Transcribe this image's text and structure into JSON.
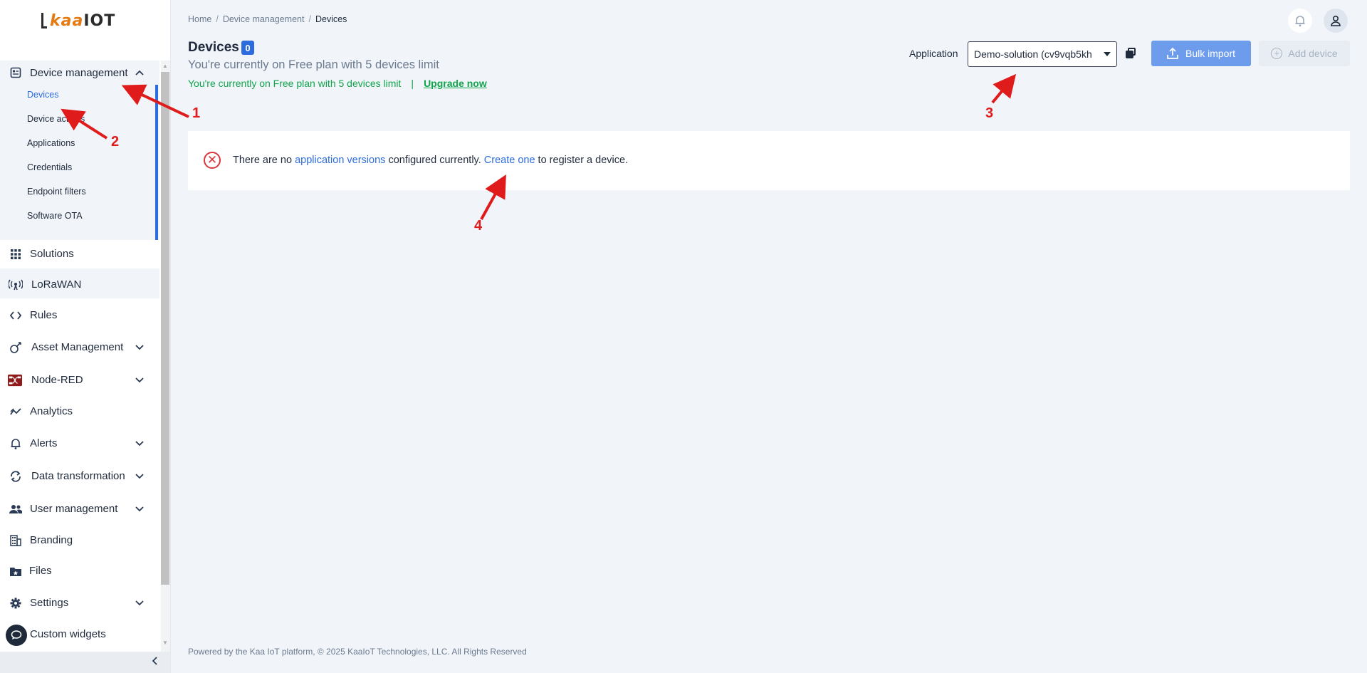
{
  "logo": {
    "text_left": "I",
    "text_kaa": "kaa",
    "text_right": "IOT"
  },
  "sidebar": {
    "group": {
      "label": "Device management",
      "items": [
        "Devices",
        "Device actions",
        "Applications",
        "Credentials",
        "Endpoint filters",
        "Software OTA"
      ],
      "active_index": 0
    },
    "items": [
      {
        "label": "Solutions",
        "icon": "grid-icon",
        "expandable": false
      },
      {
        "label": "LoRaWAN",
        "icon": "antenna-icon",
        "expandable": false
      },
      {
        "label": "Rules",
        "icon": "code-icon",
        "expandable": false
      },
      {
        "label": "Asset Management",
        "icon": "asset-icon",
        "expandable": true
      },
      {
        "label": "Node-RED",
        "icon": "node-red-icon",
        "expandable": true
      },
      {
        "label": "Analytics",
        "icon": "analytics-icon",
        "expandable": false
      },
      {
        "label": "Alerts",
        "icon": "bell-icon",
        "expandable": true
      },
      {
        "label": "Data transformation",
        "icon": "transform-icon",
        "expandable": true
      },
      {
        "label": "User management",
        "icon": "users-icon",
        "expandable": true
      },
      {
        "label": "Branding",
        "icon": "building-icon",
        "expandable": false
      },
      {
        "label": "Files",
        "icon": "folder-icon",
        "expandable": false
      },
      {
        "label": "Settings",
        "icon": "gear-icon",
        "expandable": true
      },
      {
        "label": "Custom widgets",
        "icon": "widget-icon",
        "expandable": false
      }
    ]
  },
  "breadcrumb": [
    "Home",
    "Device management",
    "Devices"
  ],
  "header": {
    "title": "Devices",
    "count": "0",
    "subtitle": "You're currently on Free plan with 5 devices limit",
    "plan_notice": "You're currently on Free plan with 5 devices limit",
    "plan_separator": "|",
    "upgrade_link": "Upgrade now"
  },
  "toolbar": {
    "application_label": "Application",
    "application_value": "Demo-solution (cv9vqb5kh",
    "bulk_import_label": "Bulk import",
    "add_device_label": "Add device"
  },
  "alert": {
    "part1": "There are no ",
    "link1": "application versions",
    "part2": " configured currently. ",
    "link2": "Create one",
    "part3": " to register a device."
  },
  "footer": "Powered by the Kaa IoT platform, © 2025 KaaIoT Technologies, LLC. All Rights Reserved",
  "annotations": [
    "1",
    "2",
    "3",
    "4"
  ],
  "colors": {
    "accent": "#2d6cdf",
    "success": "#11a44a",
    "error": "#d9363e",
    "annotation": "#e01b1b"
  }
}
